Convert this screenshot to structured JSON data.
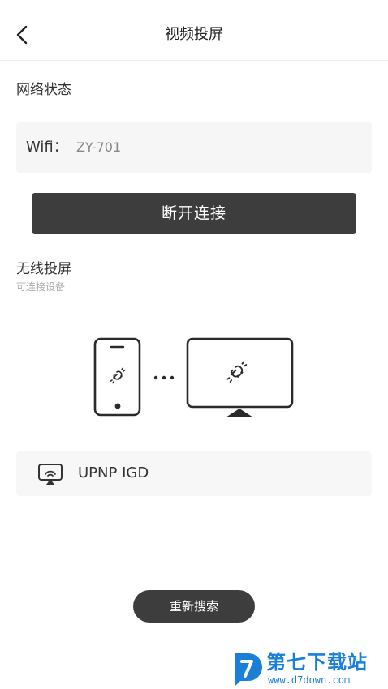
{
  "header": {
    "title": "视频投屏"
  },
  "network": {
    "section_title": "网络状态",
    "wifi_label": "Wifi：",
    "wifi_value": "ZY-701",
    "disconnect_label": "断开连接"
  },
  "wireless": {
    "section_title": "无线投屏",
    "subtitle": "可连接设备",
    "devices": [
      {
        "name": "UPNP IGD"
      }
    ],
    "research_label": "重新搜索"
  },
  "watermark": {
    "brand": "第七下载站",
    "url": "www.d7down.com"
  },
  "colors": {
    "button_bg": "#3d3d3d",
    "watermark_blue": "#1a7fd6"
  }
}
